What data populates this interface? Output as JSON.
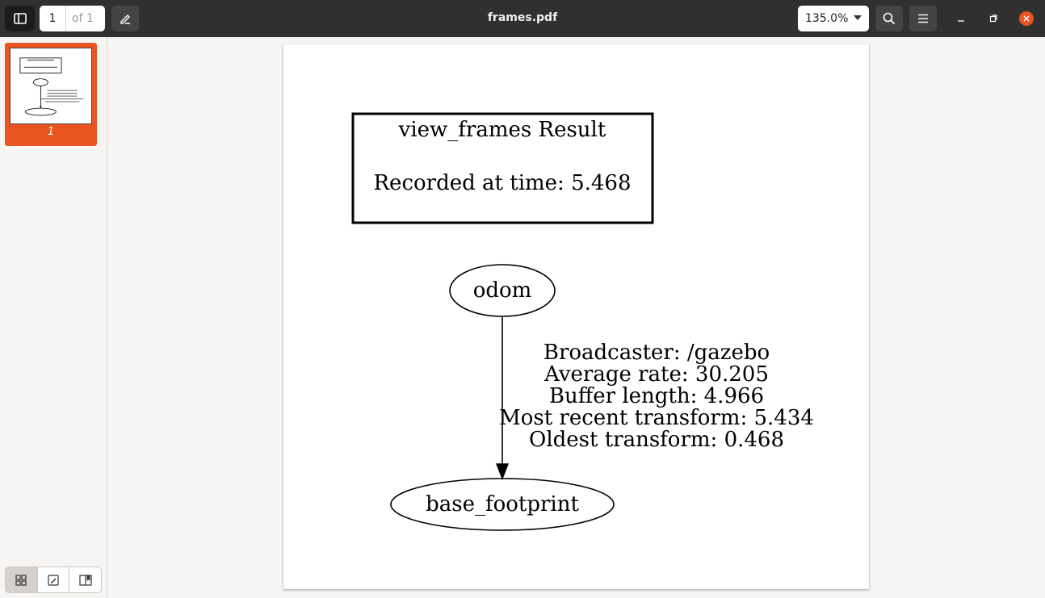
{
  "header": {
    "title": "frames.pdf",
    "page_current": "1",
    "page_of": "of 1",
    "zoom": "135.0%"
  },
  "sidebar": {
    "thumbnails": [
      {
        "label": "1"
      }
    ],
    "view_buttons": [
      "thumbnails-icon",
      "annotations-icon",
      "bookmarks-icon"
    ]
  },
  "document": {
    "result_box": {
      "title": "view_frames Result",
      "recorded": "Recorded at time: 5.468"
    },
    "nodes": {
      "parent": "odom",
      "child": "base_footprint"
    },
    "edge_info": [
      "Broadcaster: /gazebo",
      "Average rate: 30.205",
      "Buffer length: 4.966",
      "Most recent transform: 5.434",
      "Oldest transform: 0.468"
    ]
  },
  "colors": {
    "accent": "#e95420",
    "headerbar": "#303030"
  }
}
